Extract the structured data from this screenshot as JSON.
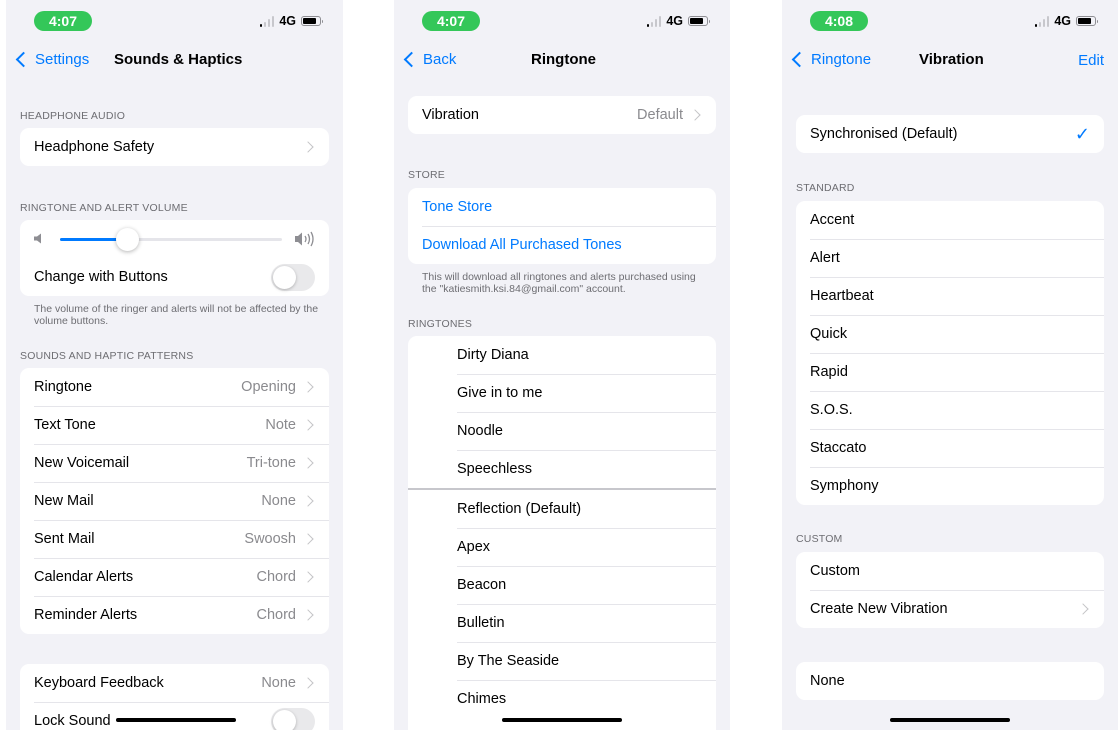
{
  "screen1": {
    "time": "4:07",
    "network": "4G",
    "back_label": "Settings",
    "title": "Sounds & Haptics",
    "headphone_header": "HEADPHONE AUDIO",
    "headphone_safety": "Headphone Safety",
    "volume_header": "RINGTONE AND ALERT VOLUME",
    "volume_level": 0.3,
    "change_with_buttons": "Change with Buttons",
    "change_with_buttons_on": false,
    "volume_footnote": "The volume of the ringer and alerts will not be affected by the volume buttons.",
    "patterns_header": "SOUNDS AND HAPTIC PATTERNS",
    "patterns": [
      {
        "label": "Ringtone",
        "value": "Opening"
      },
      {
        "label": "Text Tone",
        "value": "Note"
      },
      {
        "label": "New Voicemail",
        "value": "Tri-tone"
      },
      {
        "label": "New Mail",
        "value": "None"
      },
      {
        "label": "Sent Mail",
        "value": "Swoosh"
      },
      {
        "label": "Calendar Alerts",
        "value": "Chord"
      },
      {
        "label": "Reminder Alerts",
        "value": "Chord"
      }
    ],
    "keyboard_feedback": {
      "label": "Keyboard Feedback",
      "value": "None"
    },
    "lock_sound": {
      "label": "Lock Sound",
      "on": false
    }
  },
  "screen2": {
    "time": "4:07",
    "network": "4G",
    "back_label": "Back",
    "title": "Ringtone",
    "vibration": {
      "label": "Vibration",
      "value": "Default"
    },
    "store_header": "STORE",
    "tone_store": "Tone Store",
    "download_all": "Download All Purchased Tones",
    "store_footnote": "This will download all ringtones and alerts purchased using the \"katiesmith.ksi.84@gmail.com\" account.",
    "ringtones_header": "RINGTONES",
    "custom_tones": [
      "Dirty Diana",
      "Give in to me",
      "Noodle",
      "Speechless"
    ],
    "tones": [
      "Reflection (Default)",
      "Apex",
      "Beacon",
      "Bulletin",
      "By The Seaside",
      "Chimes"
    ]
  },
  "screen3": {
    "time": "4:08",
    "network": "4G",
    "back_label": "Ringtone",
    "title": "Vibration",
    "edit_label": "Edit",
    "synchronised": "Synchronised (Default)",
    "checkmark": "✓",
    "standard_header": "STANDARD",
    "standard": [
      "Accent",
      "Alert",
      "Heartbeat",
      "Quick",
      "Rapid",
      "S.O.S.",
      "Staccato",
      "Symphony"
    ],
    "custom_header": "CUSTOM",
    "custom": "Custom",
    "create_new": "Create New Vibration",
    "none": "None"
  },
  "colors": {
    "accent": "#007aff",
    "time_pill": "#34c759",
    "background": "#f2f2f7"
  }
}
